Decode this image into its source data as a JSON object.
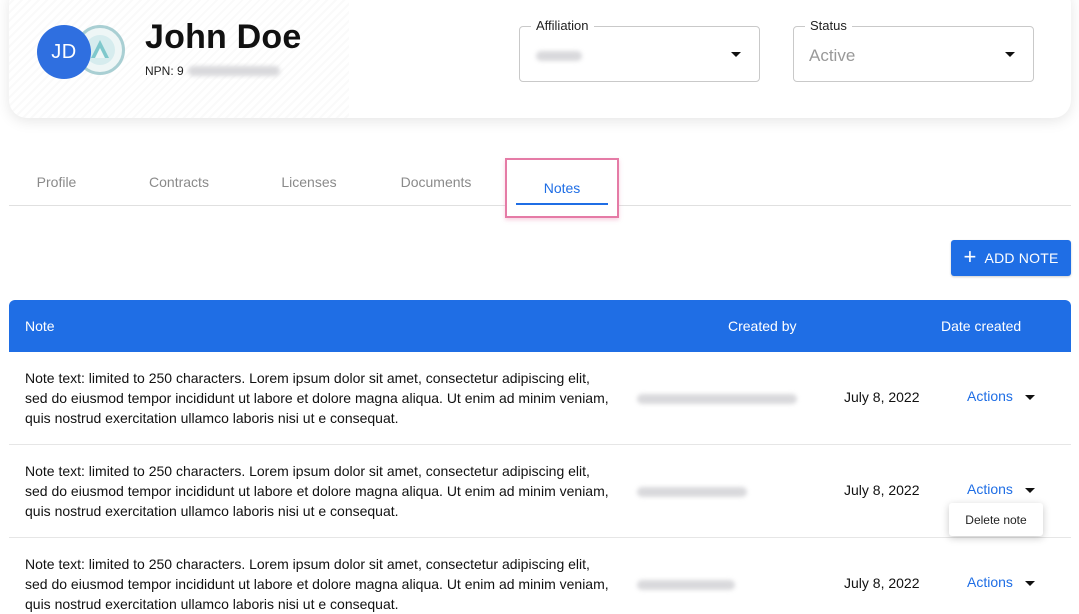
{
  "agent": {
    "initials": "JD",
    "name": "John Doe",
    "npn_label": "NPN: 9"
  },
  "filters": {
    "affiliation_label": "Affiliation",
    "status_label": "Status",
    "status_value": "Active"
  },
  "tabs": [
    {
      "label": "Profile",
      "active": false
    },
    {
      "label": "Contracts",
      "active": false
    },
    {
      "label": "Licenses",
      "active": false
    },
    {
      "label": "Documents",
      "active": false
    },
    {
      "label": "Notes",
      "active": true
    }
  ],
  "toolbar": {
    "add_note_label": "ADD NOTE"
  },
  "table": {
    "columns": [
      "Note",
      "Created by",
      "Date created"
    ],
    "rows": [
      {
        "note": "Note text: limited to 250 characters. Lorem ipsum dolor sit amet, consectetur adipiscing elit, sed do eiusmod tempor incididunt ut labore et dolore magna aliqua. Ut enim ad minim veniam, quis nostrud exercitation ullamco laboris nisi ut e consequat.",
        "date": "July 8, 2022",
        "actions_label": "Actions"
      },
      {
        "note": "Note text: limited to 250 characters. Lorem ipsum dolor sit amet, consectetur adipiscing elit, sed do eiusmod tempor incididunt ut labore et dolore magna aliqua. Ut enim ad minim veniam, quis nostrud exercitation ullamco laboris nisi ut e consequat.",
        "date": "July 8, 2022",
        "actions_label": "Actions"
      },
      {
        "note": "Note text: limited to 250 characters. Lorem ipsum dolor sit amet, consectetur adipiscing elit, sed do eiusmod tempor incididunt ut labore et dolore magna aliqua. Ut enim ad minim veniam, quis nostrud exercitation ullamco laboris nisi ut e consequat.",
        "date": "July 8, 2022",
        "actions_label": "Actions"
      }
    ]
  },
  "actions_menu": {
    "items": [
      "Delete note"
    ]
  },
  "colors": {
    "primary": "#1f6ee5",
    "avatar": "#2f6fe0",
    "highlight_border": "#e57ba6"
  }
}
